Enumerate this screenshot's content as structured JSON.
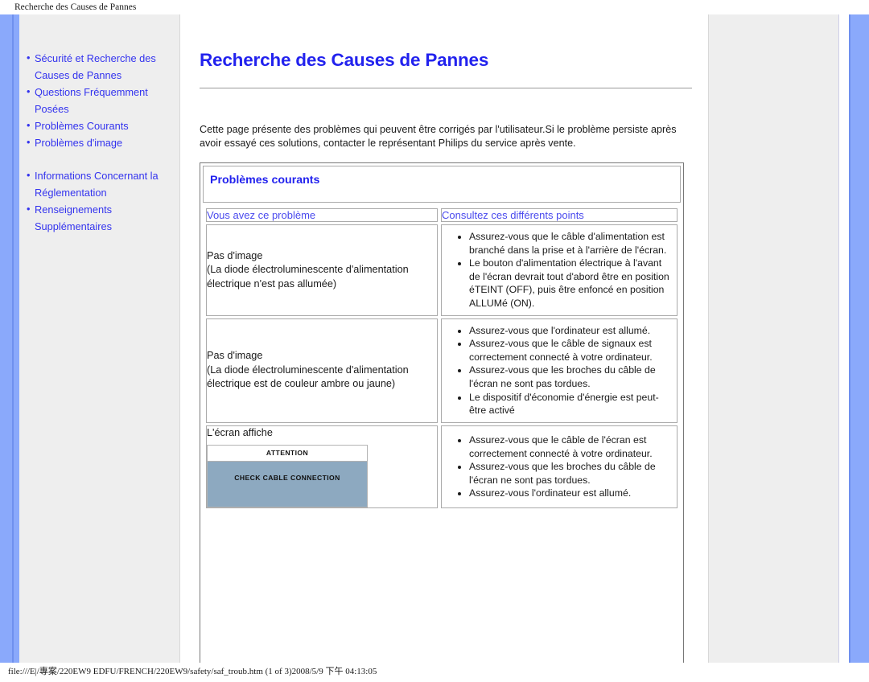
{
  "browser": {
    "print_header": "Recherche des Causes de Pannes",
    "footer_path": "file:///E|/專案/220EW9 EDFU/FRENCH/220EW9/safety/saf_troub.htm (1 of 3)2008/5/9 下午 04:13:05"
  },
  "colors": {
    "link_blue": "#3333ee",
    "heading_blue": "#2222ee",
    "column_header_blue": "#4a4aee",
    "gutter_blue": "#8aa9fb",
    "sidebar_gray": "#eeeeee",
    "osd_panel_blue": "#8da9c0"
  },
  "sidebar": {
    "items": [
      {
        "bullet": "•",
        "label": "Sécurité et Recherche des Causes de Pannes",
        "spaced": false
      },
      {
        "bullet": "•",
        "label": "Questions Fréquemment Posées",
        "spaced": false
      },
      {
        "bullet": "•",
        "label": "Problèmes Courants",
        "spaced": false
      },
      {
        "bullet": "•",
        "label": "Problèmes d'image",
        "spaced": false
      },
      {
        "bullet": "•",
        "label": "Informations Concernant la Réglementation",
        "spaced": true
      },
      {
        "bullet": "•",
        "label": "Renseignements Supplémentaires",
        "spaced": false
      }
    ]
  },
  "main": {
    "title": "Recherche des Causes de Pannes",
    "intro": "Cette page présente des problèmes qui peuvent être corrigés par l'utilisateur.Si le problème persiste après avoir essayé ces solutions, contacter le représentant Philips du service après vente.",
    "section_title": "Problèmes courants",
    "table": {
      "headers": {
        "left": "Vous avez ce problème",
        "right": "Consultez ces différents points"
      },
      "rows": [
        {
          "problem": "Pas d'image\n(La diode électroluminescente d'alimentation électrique n'est pas allumée)",
          "checks": [
            "Assurez-vous que le câble d'alimentation est branché dans la prise et à l'arrière de l'écran.",
            "Le bouton d'alimentation électrique à l'avant de l'écran devrait tout d'abord être en position éTEINT (OFF), puis être enfoncé en position ALLUMé (ON)."
          ]
        },
        {
          "problem": "Pas d'image\n(La diode électroluminescente d'alimentation électrique est de couleur ambre ou jaune)",
          "checks": [
            "Assurez-vous que l'ordinateur est allumé.",
            "Assurez-vous que le câble de signaux est correctement connecté à votre ordinateur.",
            "Assurez-vous que les broches du câble de l'écran ne sont pas tordues.",
            "Le dispositif d'économie d'énergie est peut-être activé"
          ]
        },
        {
          "problem": "L'écran affiche",
          "osd": {
            "title": "ATTENTION",
            "message": "CHECK CABLE CONNECTION"
          },
          "checks": [
            "Assurez-vous que le câble de l'écran est correctement connecté à votre ordinateur.",
            "Assurez-vous que les broches du câble de l'écran ne sont pas tordues.",
            "Assurez-vous l'ordinateur est allumé."
          ]
        }
      ]
    }
  }
}
